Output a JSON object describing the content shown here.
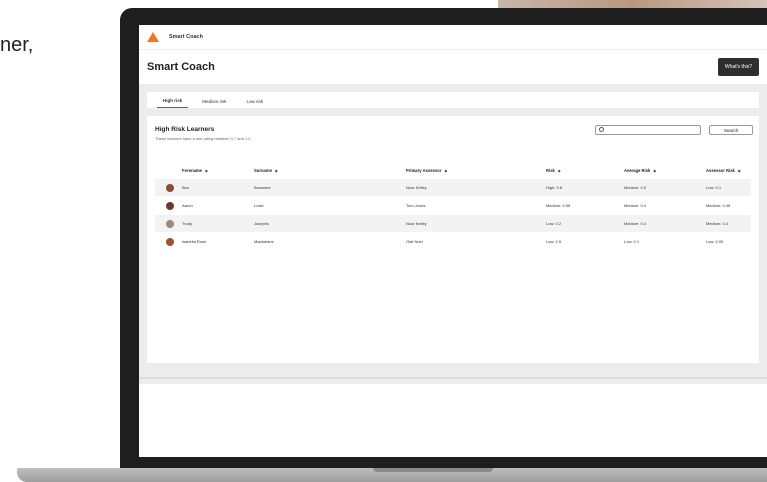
{
  "left_text": "ner,",
  "app": {
    "brand": "Smart Coach",
    "title": "Smart Coach",
    "whats_this": "What's this?"
  },
  "tabs": [
    "High risk",
    "Medium risk",
    "Low risk"
  ],
  "card": {
    "title": "High Risk Learners",
    "subtitle": "These learners have a risk rating between 0.7 and 1.0"
  },
  "search": {
    "placeholder": "",
    "button": "Search"
  },
  "table": {
    "headers": [
      "Forename",
      "Surname",
      "Primary Assessor",
      "Risk",
      "Average Risk",
      "Assessor Risk"
    ],
    "rows": [
      {
        "forename": "Ben",
        "surname": "Brownlee",
        "assessor": "Noor Kelley",
        "risk": "High: 0.8",
        "avg": "Medium: 0.5",
        "assessor_risk": "Low: 0.1",
        "avatar_color": "#8b4a3a"
      },
      {
        "forename": "Aaron",
        "surname": "Lowe",
        "assessor": "Tom Jones",
        "risk": "Medium: 0.55",
        "avg": "Medium: 0.4",
        "assessor_risk": "Medium: 0.45",
        "avatar_color": "#6b3a2a"
      },
      {
        "forename": "Trudy",
        "surname": "Josephs",
        "assessor": "Noor Kelley",
        "risk": "Low: 0.2",
        "avg": "Medium: 0.4",
        "assessor_risk": "Medium: 0.4",
        "avatar_color": "#9a8a80"
      },
      {
        "forename": "Isabella Rose",
        "surname": "Macfarlane",
        "assessor": "Olaf Noel",
        "risk": "Low: 0.5",
        "avg": "Low: 0.1",
        "assessor_risk": "Low: 0.05",
        "avatar_color": "#a0522d"
      }
    ]
  },
  "colors": {
    "accent": "#f07a1a",
    "tab_active": "#2b6cb0",
    "dark_button": "#2e2e2e"
  }
}
